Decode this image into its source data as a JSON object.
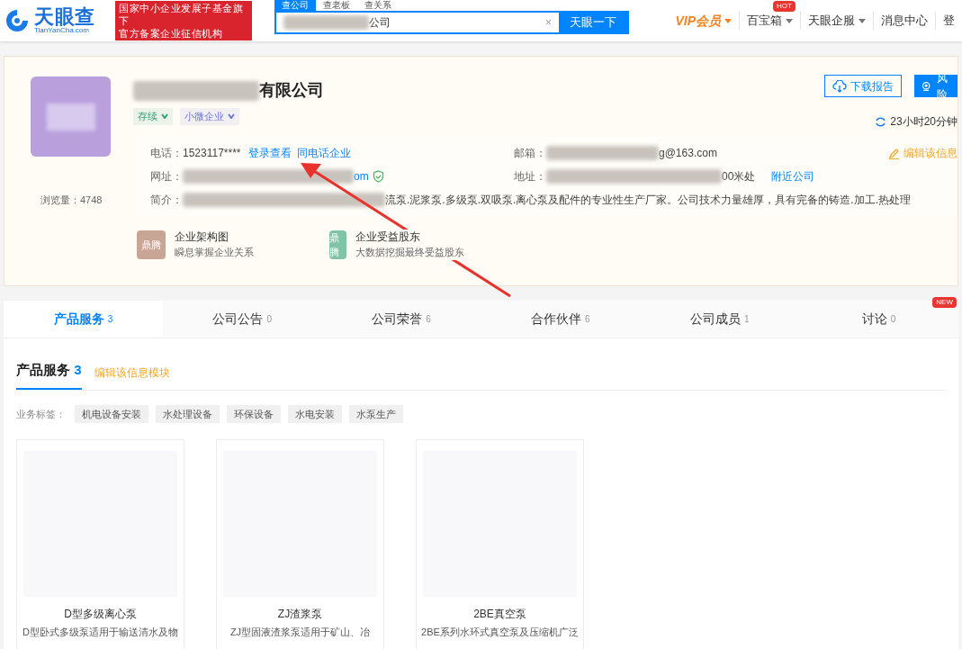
{
  "header": {
    "logo": {
      "name": "天眼查",
      "domain": "TianYanCha.com"
    },
    "badge": [
      "国家中小企业发展子基金旗下",
      "官方备案企业征信机构"
    ],
    "search": {
      "tabs": [
        {
          "label": "查公司",
          "selected": true
        },
        {
          "label": "查老板",
          "selected": false
        },
        {
          "label": "查关系",
          "selected": false
        }
      ],
      "value": "公司",
      "clear": "×",
      "button": "天眼一下"
    },
    "nav": [
      {
        "label": "VIP会员",
        "kind": "vip",
        "dropdown": true
      },
      {
        "label": "百宝箱",
        "kind": "plain",
        "dropdown": true,
        "badge": "HOT"
      },
      {
        "label": "天眼企服",
        "kind": "plain",
        "dropdown": true
      },
      {
        "label": "消息中心",
        "kind": "plain",
        "dropdown": false
      },
      {
        "label": "登",
        "kind": "plain",
        "dropdown": false
      }
    ]
  },
  "company": {
    "name": "有限公司",
    "tags": [
      {
        "label": "存续",
        "color": "#2ba471"
      },
      {
        "label": "小微企业",
        "color": "#6b75d6"
      }
    ],
    "views": "浏览量：4748",
    "buttons": [
      {
        "label": "下载报告",
        "kind": "outline"
      },
      {
        "label": "风险",
        "kind": "primary"
      }
    ],
    "updated": "23小时20分钟",
    "edit_link": "编辑该信息",
    "phone": {
      "label": "电话：",
      "value": "1523117****",
      "links": [
        "登录查看",
        "同电话企业"
      ]
    },
    "email": {
      "label": "邮箱：",
      "value": "g@163.com"
    },
    "website": {
      "label": "网址：",
      "value": "om",
      "verified": true
    },
    "address": {
      "label": "地址：",
      "value": "00米处",
      "link": "附近公司"
    },
    "intro": {
      "label": "简介：",
      "value": "流泵.泥浆泵.多级泵.双吸泵.离心泵及配件的专业性生产厂家。公司技术力量雄厚，具有完备的铸造.加工.热处理"
    },
    "features": [
      {
        "icon_text": "鼎腾",
        "color": "#c9a596",
        "title": "企业架构图",
        "subtitle": "瞬息掌握企业关系"
      },
      {
        "icon_text": "鼎腾",
        "color": "#7fc3a8",
        "title": "企业受益股东",
        "subtitle": "大数据挖掘最终受益股东"
      }
    ]
  },
  "tabs": [
    {
      "label": "产品服务",
      "count": "3",
      "selected": true
    },
    {
      "label": "公司公告",
      "count": "0",
      "selected": false
    },
    {
      "label": "公司荣誉",
      "count": "6",
      "selected": false
    },
    {
      "label": "合作伙伴",
      "count": "6",
      "selected": false
    },
    {
      "label": "公司成员",
      "count": "1",
      "selected": false
    },
    {
      "label": "讨论",
      "count": "0",
      "selected": false,
      "badge": "NEW"
    }
  ],
  "section": {
    "title": "产品服务",
    "count": "3",
    "edit_link": "编辑该信息模块",
    "tag_label": "业务标签：",
    "tags": [
      "机电设备安装",
      "水处理设备",
      "环保设备",
      "水电安装",
      "水泵生产"
    ],
    "products": [
      {
        "name": "D型多级离心泵",
        "desc": "D型卧式多级泵适用于输送清水及物"
      },
      {
        "name": "ZJ渣浆泵",
        "desc": "ZJ型固液渣浆泵适用于矿山、冶"
      },
      {
        "name": "2BE真空泵",
        "desc": "2BE系列水环式真空泵及压缩机广泛"
      }
    ]
  }
}
